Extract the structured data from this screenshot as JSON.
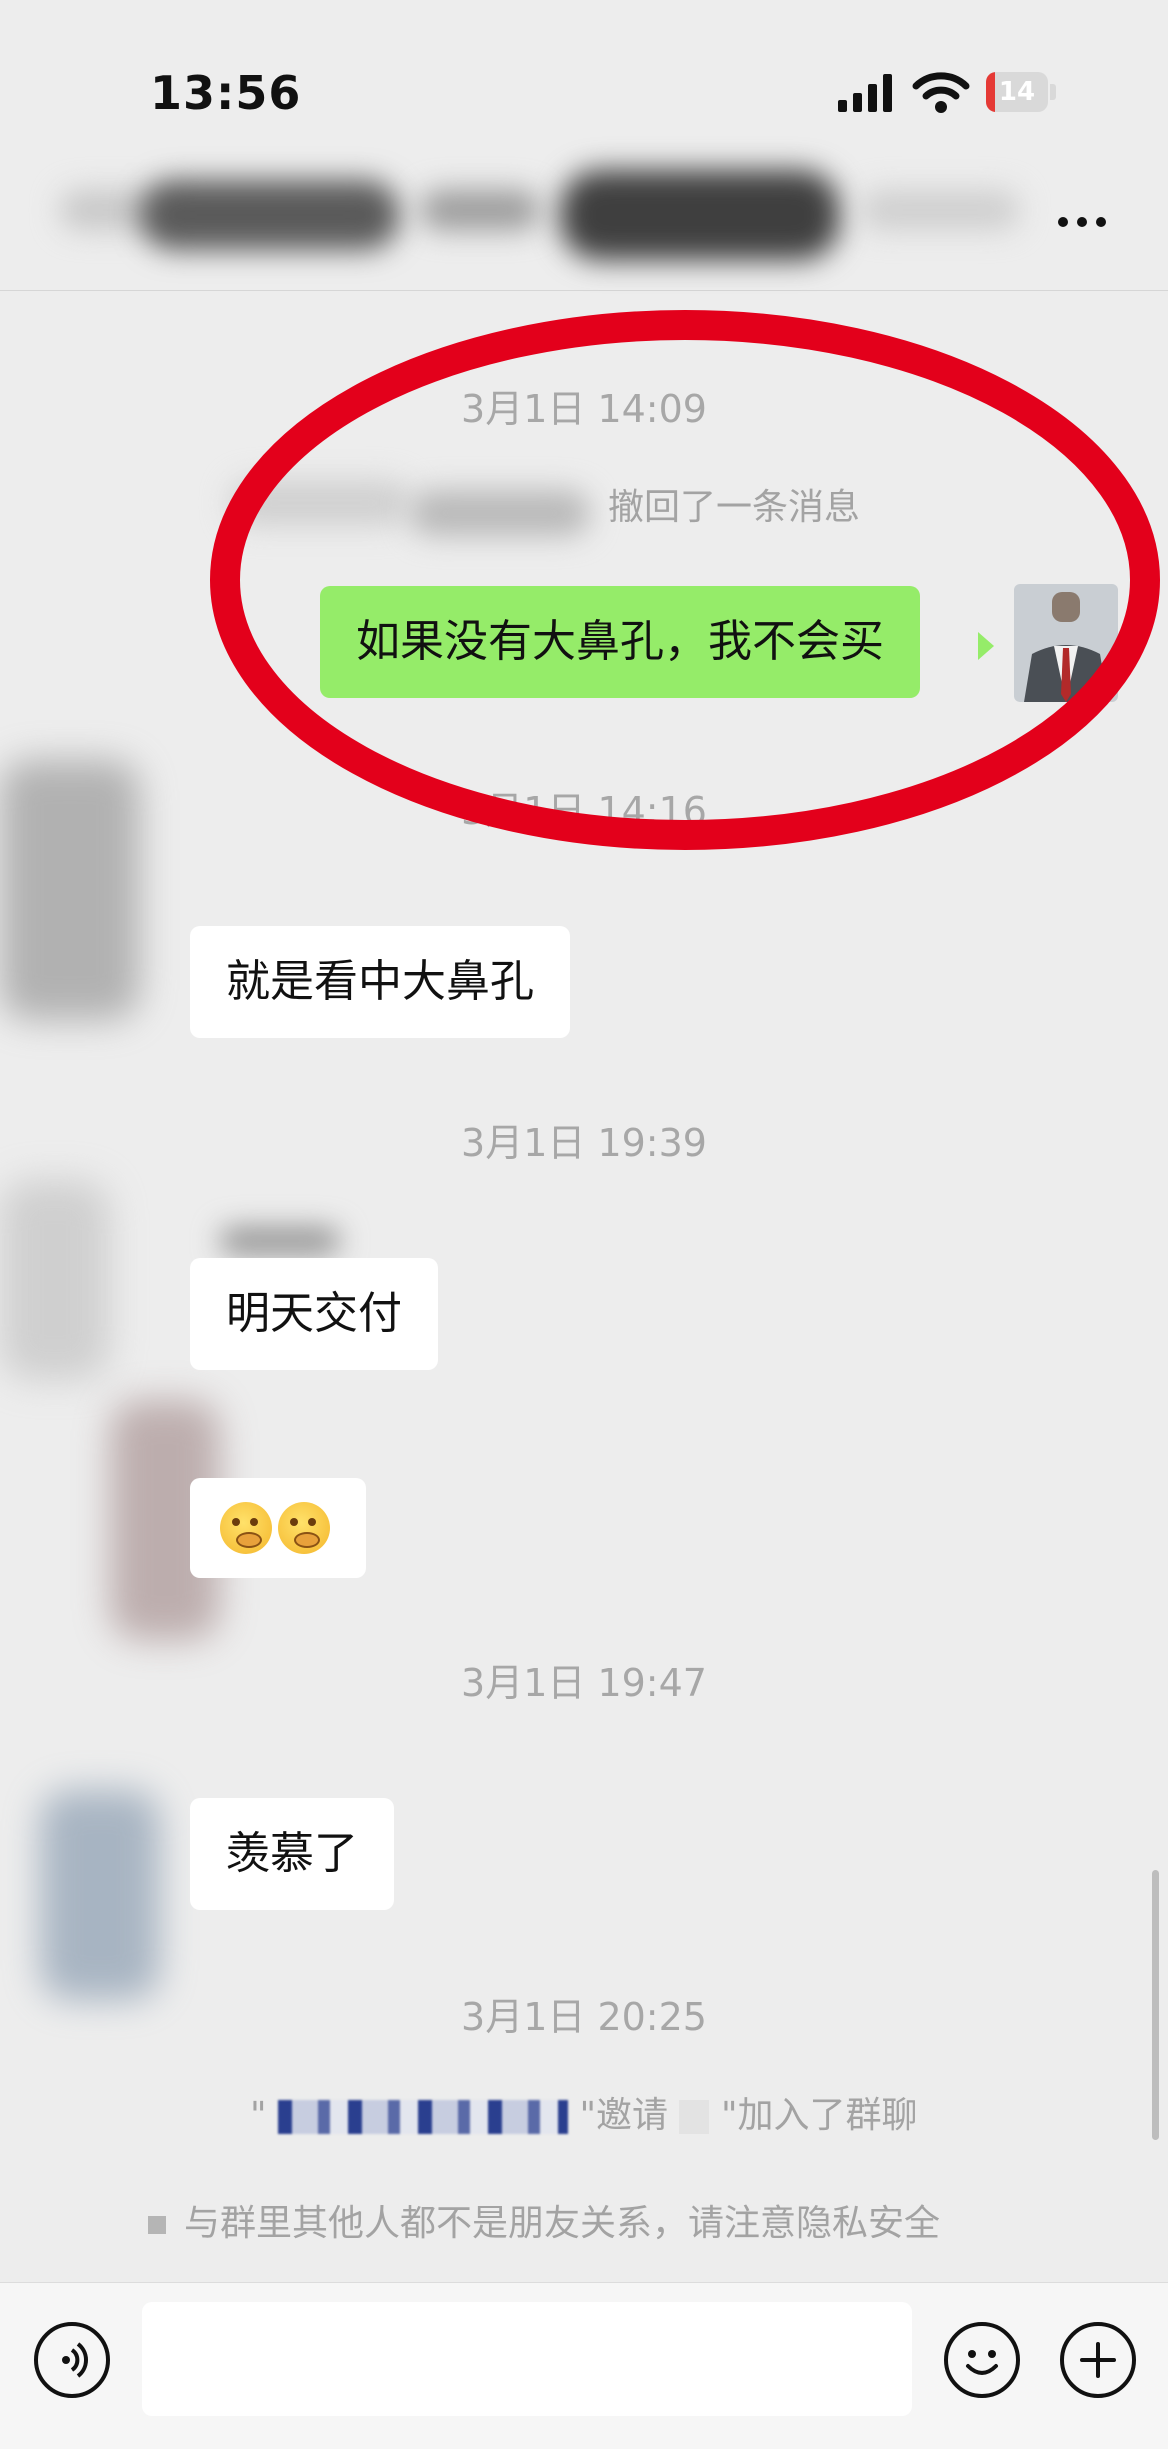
{
  "status_bar": {
    "time": "13:56",
    "battery": "14",
    "battery_level": 0.14,
    "battery_color": "#e53935"
  },
  "header": {
    "more_icon": "more-horizontal-icon"
  },
  "messages": {
    "ts1": "3月1日 14:09",
    "recall_text": "撤回了一条消息",
    "sent_text": "如果没有大鼻孔，我不会买",
    "ts2": "3月1日 14:16",
    "msg1": "就是看中大鼻孔",
    "ts3": "3月1日 19:39",
    "msg2": "明天交付",
    "msg3_emoji": "face-with-hand-over-mouth-emoji",
    "ts4": "3月1日 19:47",
    "msg4": "羡慕了",
    "ts5": "3月1日 20:25",
    "invite_part1": "\"",
    "invite_part2": "\"邀请",
    "invite_part3": "\"加入了群聊",
    "privacy_notice": "与群里其他人都不是朋友关系，请注意隐私安全"
  },
  "annotation": {
    "circle_color": "#e3001b"
  },
  "input_bar": {
    "voice_icon": "voice-icon",
    "emoji_icon": "smile-icon",
    "plus_icon": "plus-icon",
    "text_value": ""
  },
  "colors": {
    "sent_bubble": "#95ec69",
    "received_bubble": "#ffffff",
    "background": "#ededed"
  }
}
